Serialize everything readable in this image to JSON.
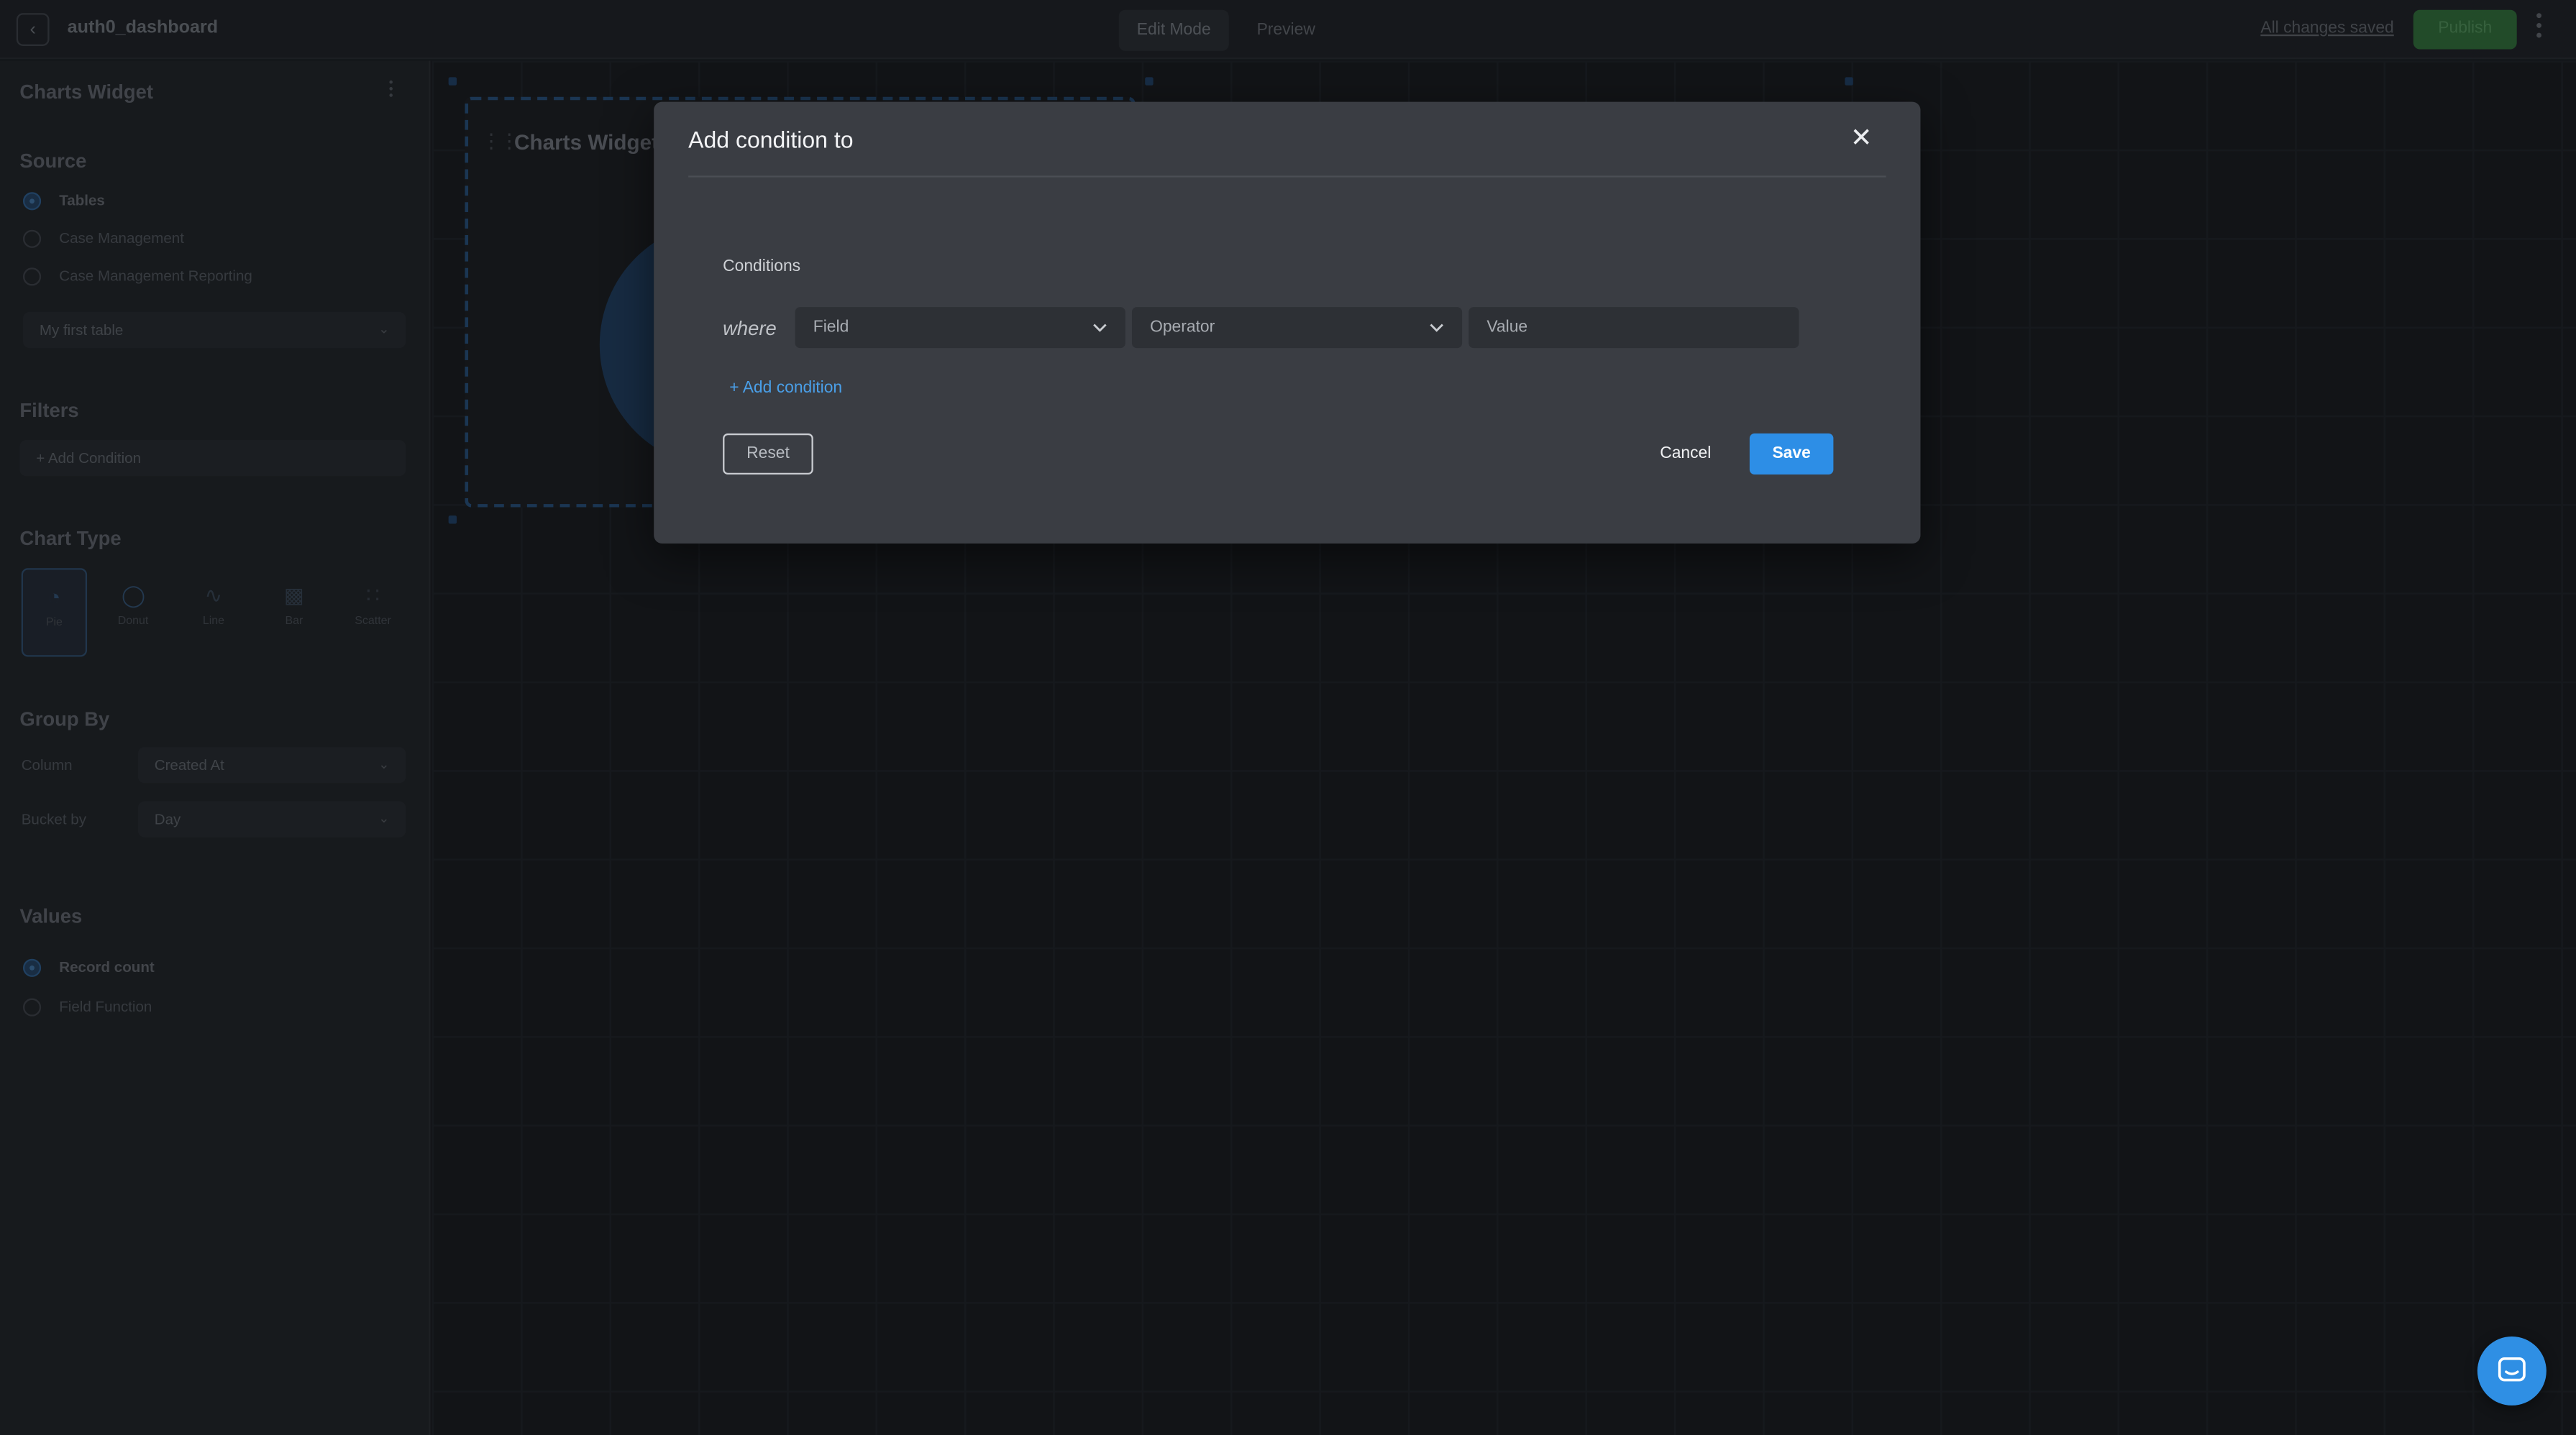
{
  "topbar": {
    "app_name": "auth0_dashboard",
    "tabs": [
      {
        "label": "Edit Mode"
      },
      {
        "label": "Preview"
      }
    ],
    "status_text": "All changes saved",
    "publish_label": "Publish"
  },
  "sidebar": {
    "widget_title": "Charts Widget",
    "source": {
      "title": "Source",
      "options": [
        {
          "label": "Tables"
        },
        {
          "label": "Case Management"
        },
        {
          "label": "Case Management Reporting"
        }
      ],
      "selected_table": "My first table"
    },
    "filters": {
      "title": "Filters",
      "add_label": "+ Add Condition"
    },
    "chart_type": {
      "title": "Chart Type",
      "items": [
        {
          "label": "Pie",
          "icon": "pie-icon"
        },
        {
          "label": "Donut",
          "icon": "donut-icon"
        },
        {
          "label": "Line",
          "icon": "line-icon"
        },
        {
          "label": "Bar",
          "icon": "bar-icon"
        },
        {
          "label": "Scatter",
          "icon": "scatter-icon"
        }
      ],
      "selected": "Pie"
    },
    "group_by": {
      "title": "Group By",
      "column_label": "Column",
      "column_value": "Created At",
      "bucket_label": "Bucket by",
      "bucket_value": "Day"
    },
    "values": {
      "title": "Values",
      "options": [
        {
          "label": "Record count"
        },
        {
          "label": "Field Function"
        }
      ]
    }
  },
  "canvas": {
    "widget_title": "Charts Widget"
  },
  "modal": {
    "title": "Add condition to",
    "conditions_label": "Conditions",
    "where_label": "where",
    "field_placeholder": "Field",
    "operator_placeholder": "Operator",
    "value_placeholder": "Value",
    "add_condition_label": "+ Add condition",
    "reset_label": "Reset",
    "cancel_label": "Cancel",
    "save_label": "Save"
  },
  "colors": {
    "accent": "#2d8ee6",
    "link": "#4a9fe8",
    "modal_bg": "#3a3d43",
    "publish": "#2d6b35"
  }
}
